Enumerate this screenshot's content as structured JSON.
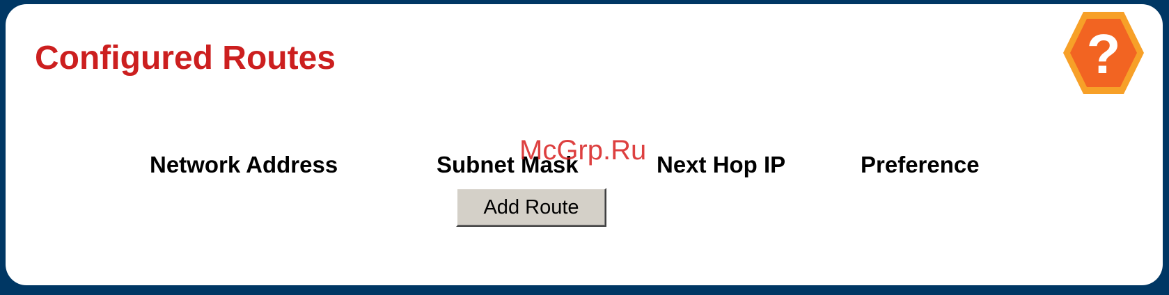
{
  "page": {
    "title": "Configured Routes"
  },
  "help": {
    "icon": "help-icon",
    "glyph": "?",
    "outer_color": "#f7a028",
    "inner_color": "#f26422"
  },
  "table": {
    "columns": [
      "Network Address",
      "Subnet Mask",
      "Next Hop IP",
      "Preference"
    ]
  },
  "actions": {
    "add_route_label": "Add Route"
  },
  "watermark": {
    "text": "McGrp.Ru"
  },
  "colors": {
    "background": "#003764",
    "title": "#cc1f1f",
    "button_face": "#d4d0c8"
  }
}
